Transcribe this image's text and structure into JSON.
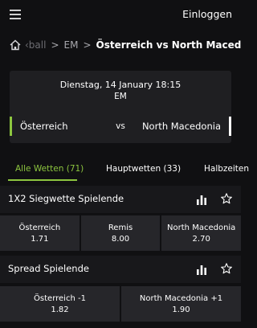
{
  "header": {
    "login_label": "Einloggen"
  },
  "breadcrumb": {
    "items": [
      "‹ball",
      "EM",
      "Österreich vs North Macedonia"
    ],
    "separator": ">"
  },
  "match": {
    "datetime": "Dienstag, 14 January 18:15",
    "competition": "EM",
    "home_team": "Österreich",
    "vs_label": "vs",
    "away_team": "North Macedonia"
  },
  "tabs": [
    {
      "label": "Alle Wetten (71)",
      "active": true
    },
    {
      "label": "Hauptwetten (33)",
      "active": false
    },
    {
      "label": "Halbzeiten",
      "active": false
    }
  ],
  "markets": [
    {
      "title": "1X2 Siegwette Spielende",
      "outcomes": [
        {
          "label": "Österreich",
          "odds": "1.71"
        },
        {
          "label": "Remis",
          "odds": "8.00"
        },
        {
          "label": "North Macedonia",
          "odds": "2.70"
        }
      ]
    },
    {
      "title": "Spread Spielende",
      "outcomes": [
        {
          "label": "Österreich -1",
          "odds": "1.82"
        },
        {
          "label": "North Macedonia +1",
          "odds": "1.90"
        }
      ]
    }
  ],
  "icons": {
    "menu": "hamburger-menu-icon",
    "home": "home-icon",
    "stats": "bar-chart-icon",
    "favorite": "star-icon"
  },
  "colors": {
    "accent": "#8dc63f",
    "background": "#101012",
    "card": "#1f1f22",
    "odds_button": "#26262a"
  }
}
